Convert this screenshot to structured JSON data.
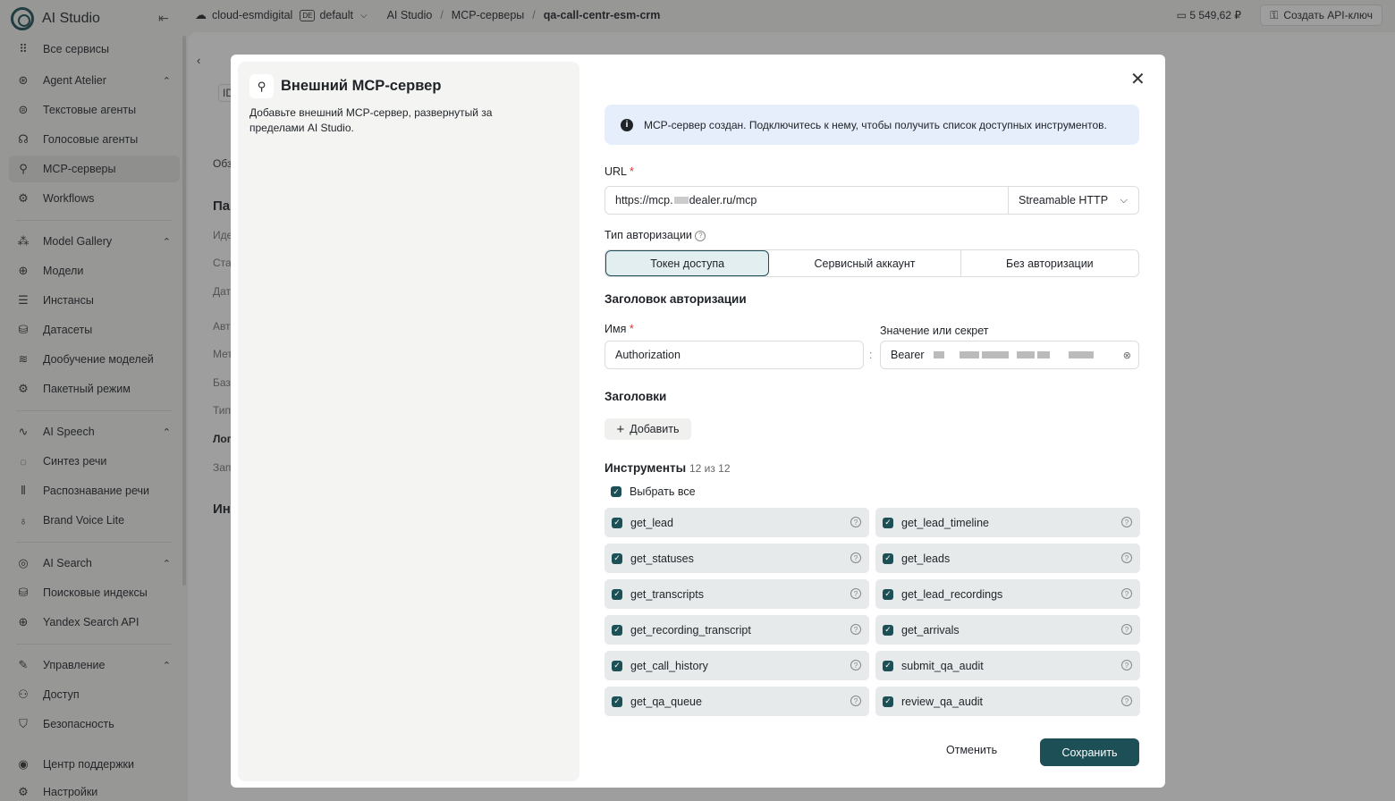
{
  "sidebar": {
    "app_name": "AI Studio",
    "items": [
      {
        "label": "Все сервисы",
        "icon": "grid-icon",
        "glyph": "⠿"
      },
      {
        "label": "Agent Atelier",
        "icon": "agent-icon",
        "glyph": "⊛",
        "group": true
      },
      {
        "label": "Текстовые агенты",
        "icon": "text-agent-icon",
        "glyph": "⊜"
      },
      {
        "label": "Голосовые агенты",
        "icon": "headset-icon",
        "glyph": "☊"
      },
      {
        "label": "MCP-серверы",
        "icon": "mcp-icon",
        "glyph": "⚲",
        "active": true
      },
      {
        "label": "Workflows",
        "icon": "workflow-icon",
        "glyph": "⚙"
      },
      {
        "label": "Model Gallery",
        "icon": "gallery-icon",
        "glyph": "⁂",
        "group": true
      },
      {
        "label": "Модели",
        "icon": "model-icon",
        "glyph": "⊕"
      },
      {
        "label": "Инстансы",
        "icon": "instance-icon",
        "glyph": "☰"
      },
      {
        "label": "Датасеты",
        "icon": "dataset-icon",
        "glyph": "⛁"
      },
      {
        "label": "Дообучение моделей",
        "icon": "tuning-icon",
        "glyph": "≋"
      },
      {
        "label": "Пакетный режим",
        "icon": "batch-icon",
        "glyph": "⚙"
      },
      {
        "label": "AI Speech",
        "icon": "speech-icon",
        "glyph": "∿",
        "group": true
      },
      {
        "label": "Синтез речи",
        "icon": "synthesis-icon",
        "glyph": "◌"
      },
      {
        "label": "Распознавание речи",
        "icon": "recognition-icon",
        "glyph": "⫴"
      },
      {
        "label": "Brand Voice Lite",
        "icon": "voice-icon",
        "glyph": "♁"
      },
      {
        "label": "AI Search",
        "icon": "search-icon",
        "glyph": "◎",
        "group": true
      },
      {
        "label": "Поисковые индексы",
        "icon": "index-icon",
        "glyph": "⛁"
      },
      {
        "label": "Yandex Search API",
        "icon": "globe-icon",
        "glyph": "⊕"
      },
      {
        "label": "Управление",
        "icon": "manage-icon",
        "glyph": "✎",
        "group": true
      },
      {
        "label": "Доступ",
        "icon": "users-icon",
        "glyph": "⚇"
      },
      {
        "label": "Безопасность",
        "icon": "shield-icon",
        "glyph": "⛉"
      },
      {
        "label": "Центр поддержки",
        "icon": "support-icon",
        "glyph": "◉"
      },
      {
        "label": "Настройки",
        "icon": "settings-icon",
        "glyph": "⚙"
      }
    ]
  },
  "topbar": {
    "cloud": "cloud-esmdigital",
    "folder_badge": "DE",
    "folder": "default",
    "crumbs": [
      "AI Studio",
      "MCP-серверы",
      "qa-call-centr-esm-crm"
    ],
    "balance": "5 549,62 ₽",
    "create_api_key": "Создать API-ключ"
  },
  "page_behind": {
    "id_label": "ID",
    "tab": "Обз",
    "section1": "Па",
    "rows": [
      "Иде",
      "Ста",
      "Дат",
      "Авт",
      "Мет",
      "Баз",
      "Тип",
      "Лог",
      "Зап"
    ],
    "section2": "Ин"
  },
  "modal": {
    "title": "Внешний MCP-сервер",
    "description": "Добавьте внешний MCP-сервер, развернутый за пределами AI Studio.",
    "info": "MCP-сервер создан. Подключитесь к нему, чтобы получить список доступных инструментов.",
    "url_label": "URL",
    "url_prefix": "https://mcp.",
    "url_suffix": "dealer.ru/mcp",
    "transport": "Streamable HTTP",
    "auth_type_label": "Тип авторизации",
    "auth_options": [
      "Токен доступа",
      "Сервисный аккаунт",
      "Без авторизации"
    ],
    "auth_header_title": "Заголовок авторизации",
    "name_label": "Имя",
    "name_value": "Authorization",
    "secret_label": "Значение или секрет",
    "secret_prefix": "Bearer",
    "headers_title": "Заголовки",
    "add_label": "Добавить",
    "tools_title": "Инструменты",
    "tools_count": "12 из 12",
    "select_all": "Выбрать все",
    "tools": [
      "get_lead",
      "get_lead_timeline",
      "get_statuses",
      "get_leads",
      "get_transcripts",
      "get_lead_recordings",
      "get_recording_transcript",
      "get_arrivals",
      "get_call_history",
      "submit_qa_audit",
      "get_qa_queue",
      "review_qa_audit"
    ],
    "cancel": "Отменить",
    "save": "Сохранить"
  }
}
